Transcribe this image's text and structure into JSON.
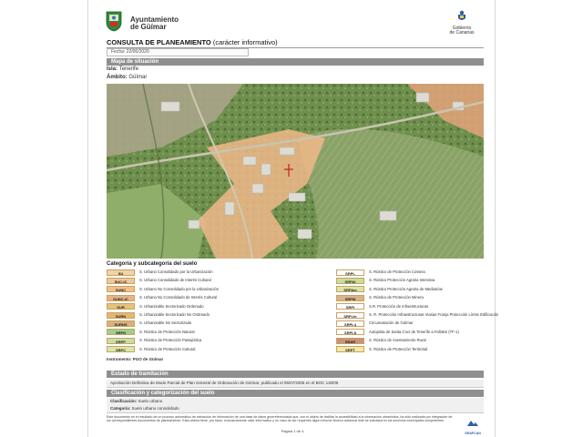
{
  "header": {
    "municipality_line1": "Ayuntamiento",
    "municipality_line2": "de Güímar",
    "gov_line1": "Gobierno",
    "gov_line2": "de Canarias"
  },
  "title": {
    "main": "CONSULTA DE PLANEAMIENTO",
    "note": "(carácter informativo)"
  },
  "fecha": "Fecha: 22/06/2020",
  "situacion": {
    "header": "Mapa de situación",
    "isla_label": "Isla:",
    "isla_value": "Tenerife",
    "ambito_label": "Ámbito:",
    "ambito_value": "Güímar"
  },
  "legend": {
    "title": "Categoría y subcategoría del suelo",
    "left": [
      {
        "code": "SU",
        "label": "S. Urbano Consolidado por la Urbanización",
        "color": "#f2d3a4"
      },
      {
        "code": "SUC-IC",
        "label": "S. Urbano Consolidado de Interés Cultural",
        "color": "#efc79a"
      },
      {
        "code": "SUNC",
        "label": "S. Urbano No Consolidado por la Urbanización",
        "color": "#f3c08a"
      },
      {
        "code": "SUNC-IC",
        "label": "S. Urbano No Consolidado de Interés Cultural",
        "color": "#e8b485"
      },
      {
        "code": "SUR",
        "label": "S. Urbanizable Sectorizado Ordenado",
        "color": "#e8c27c"
      },
      {
        "code": "SURN",
        "label": "S. Urbanizable Sectorizado No Ordenado",
        "color": "#e3b870"
      },
      {
        "code": "SURNS",
        "label": "S. Urbanizable No Sectorizado",
        "color": "#d9b27a"
      },
      {
        "code": "SRPN",
        "label": "S. Rústico de Protección Natural",
        "color": "#9fcf8c"
      },
      {
        "code": "SRPP",
        "label": "S. Rústico de Protección Paisajística",
        "color": "#c5e0a5"
      },
      {
        "code": "SRPC",
        "label": "S. Rústico de Protección Cultural",
        "color": "#d8e8a8"
      }
    ],
    "right": [
      {
        "code": "SRPL",
        "label": "S. Rústico de Protección Costera",
        "color": "#ffffff"
      },
      {
        "code": "SRPAi",
        "label": "S. Rústico Protección Agraria Intensiva",
        "color": "#c6df9a"
      },
      {
        "code": "SRPAm",
        "label": "S. Rústico Protección Agraria de Medianías",
        "color": "#d8e6a7"
      },
      {
        "code": "SRPM",
        "label": "S. Rústico de Protección Minera",
        "color": "#d9b48a"
      },
      {
        "code": "SRPI",
        "label": "S.R. Protección de Infraestructuras",
        "color": "#ffffff"
      },
      {
        "code": "SRPI-fe",
        "label": "S. R. Protección Infraestructuras Viarias Franja Protección Límite Edificación",
        "color": "#ffffff"
      },
      {
        "code": "SRPI-4",
        "label": "Circunvalación de Güímar",
        "color": "#ffffff"
      },
      {
        "code": "SRPI-8",
        "label": "Autopista de Santa Cruz de Tenerife a Fañabé (TF-1)",
        "color": "#ffffff"
      },
      {
        "code": "SRAR",
        "label": "S. Rústico de Asentamiento Rural",
        "color": "#c8937a"
      },
      {
        "code": "SRPT",
        "label": "S. Rústico de Protección Territorial",
        "color": "#f3e9a8"
      }
    ]
  },
  "instrumento": "Instrumento: PGO de Güímar",
  "tramitacion": {
    "header": "Estado de tramitación",
    "text": "Aprobación Definitiva de Modo Parcial de Plan General de Ordenación de Güímar, publicado el 05/07/2005 en el BOC 130/05"
  },
  "clasificacion": {
    "header": "Clasificación y categorización del suelo",
    "clas_label": "Clasificación:",
    "clas_value": "Suelo urbano",
    "cat_label": "Categoría:",
    "cat_value": "Suelo urbano consolidado"
  },
  "footer": {
    "text": "Este documento es el resultado de un proceso automático de extracción de información de una base de datos georreferenciada que, con el objeto de facilitar la accesibilidad a la información urbanística, ha sido realizada por integración de los correspondientes documentos de planeamiento. Esta cédula tiene, por tanto, exclusivamente valor informativo y en caso de ser requerido algún informe técnico adicional éste se solicitará en los servicios municipales competentes.",
    "page": "Página 1 de 4",
    "logo_text": "GRAFCAN"
  },
  "colors": {
    "section_bar": "#8f8f8f",
    "urban_zone": "#f0b88a"
  }
}
